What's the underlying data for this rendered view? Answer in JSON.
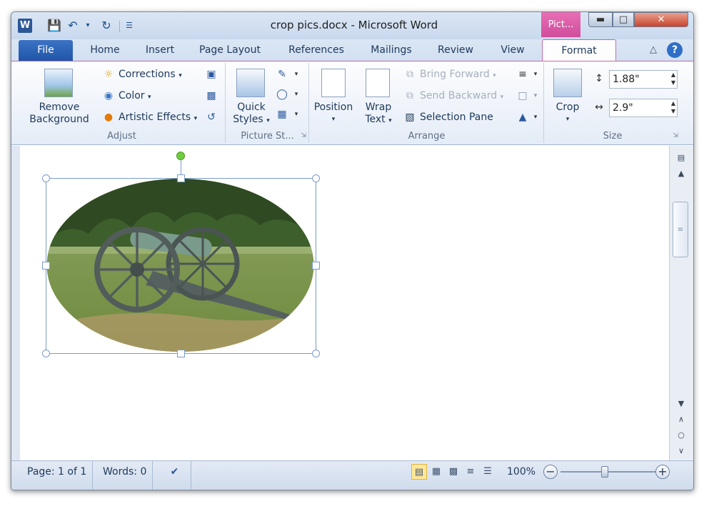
{
  "window": {
    "title": "crop pics.docx - Microsoft Word",
    "contextual_tab": "Pict..."
  },
  "tabs": {
    "file": "File",
    "items": [
      "Home",
      "Insert",
      "Page Layout",
      "References",
      "Mailings",
      "Review",
      "View",
      "Format"
    ]
  },
  "ribbon": {
    "adjust": {
      "label": "Adjust",
      "remove_background": [
        "Remove",
        "Background"
      ],
      "corrections": "Corrections",
      "color": "Color",
      "artistic_effects": "Artistic Effects"
    },
    "picture_styles": {
      "label": "Picture St...",
      "quick_styles": [
        "Quick",
        "Styles"
      ]
    },
    "arrange": {
      "label": "Arrange",
      "position": "Position",
      "wrap_text": [
        "Wrap",
        "Text"
      ],
      "bring_forward": "Bring Forward",
      "send_backward": "Send Backward",
      "selection_pane": "Selection Pane"
    },
    "size": {
      "label": "Size",
      "crop": "Crop",
      "height": "1.88\"",
      "width": "2.9\""
    }
  },
  "statusbar": {
    "page": "Page: 1 of 1",
    "words": "Words: 0",
    "zoom": "100%",
    "zoom_level": 1.0
  },
  "colors": {
    "accent_blue": "#2b5797",
    "contextual_pink": "#d04d9c",
    "status_highlight": "#ffe89a"
  }
}
